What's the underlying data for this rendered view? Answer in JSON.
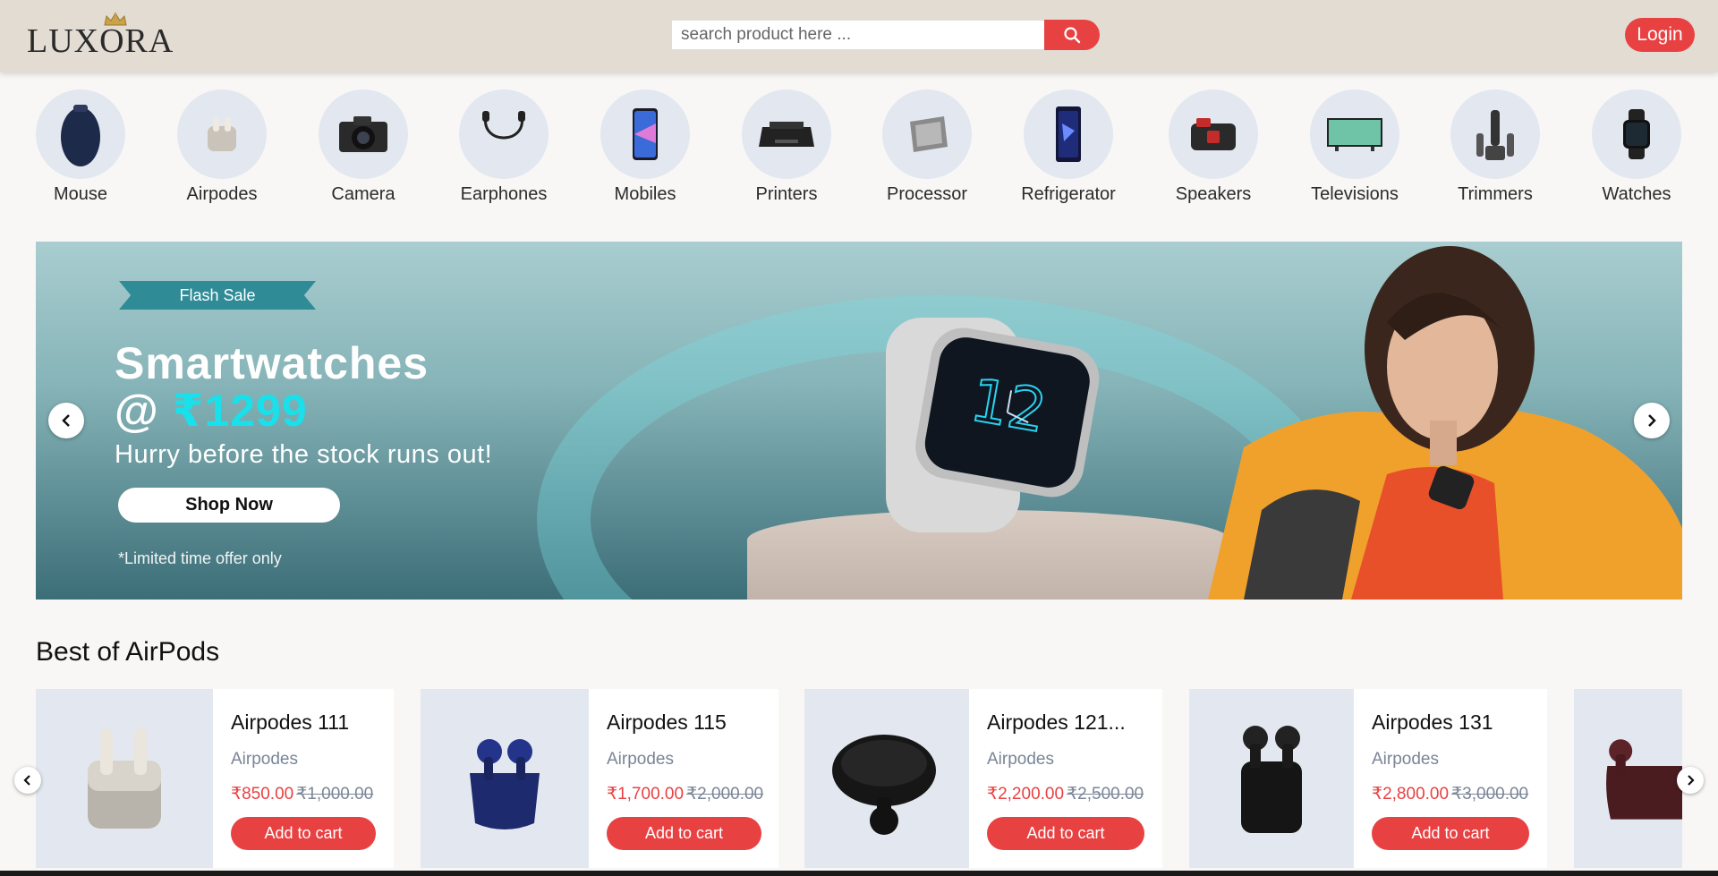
{
  "header": {
    "logo": "LUXORA",
    "search_placeholder": "search product here ...",
    "login_label": "Login",
    "accent": "#e84142"
  },
  "categories": [
    {
      "label": "Mouse",
      "icon": "mouse-icon"
    },
    {
      "label": "Airpodes",
      "icon": "airpods-icon"
    },
    {
      "label": "Camera",
      "icon": "camera-icon"
    },
    {
      "label": "Earphones",
      "icon": "earphones-icon"
    },
    {
      "label": "Mobiles",
      "icon": "mobile-icon"
    },
    {
      "label": "Printers",
      "icon": "printer-icon"
    },
    {
      "label": "Processor",
      "icon": "processor-icon"
    },
    {
      "label": "Refrigerator",
      "icon": "refrigerator-icon"
    },
    {
      "label": "Speakers",
      "icon": "speaker-icon"
    },
    {
      "label": "Televisions",
      "icon": "television-icon"
    },
    {
      "label": "Trimmers",
      "icon": "trimmer-icon"
    },
    {
      "label": "Watches",
      "icon": "watch-icon"
    }
  ],
  "banner": {
    "tag": "Flash Sale",
    "headline": "Smartwatches",
    "price_prefix": "@ ",
    "price": "₹1299",
    "subline": "Hurry before the stock runs out!",
    "cta": "Shop Now",
    "disclaimer": "*Limited time offer only"
  },
  "section": {
    "title": "Best of AirPods",
    "products": [
      {
        "name": "Airpodes 111",
        "brand": "Airpodes",
        "price": "₹850.00",
        "old_price": "₹1,000.00",
        "cta": "Add to cart"
      },
      {
        "name": "Airpodes 115",
        "brand": "Airpodes",
        "price": "₹1,700.00",
        "old_price": "₹2,000.00",
        "cta": "Add to cart"
      },
      {
        "name": "Airpodes 121...",
        "brand": "Airpodes",
        "price": "₹2,200.00",
        "old_price": "₹2,500.00",
        "cta": "Add to cart"
      },
      {
        "name": "Airpodes 131",
        "brand": "Airpodes",
        "price": "₹2,800.00",
        "old_price": "₹3,000.00",
        "cta": "Add to cart"
      }
    ]
  }
}
